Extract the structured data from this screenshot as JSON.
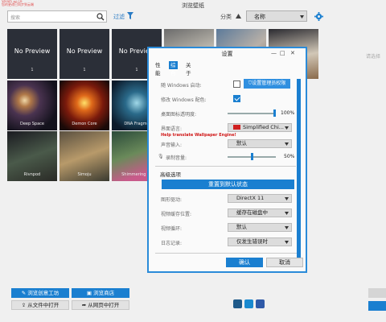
{
  "window": {
    "title": "浏览壁纸",
    "brand_line1": "Steam 云已开",
    "brand_line2": "您的更改已同步到云端"
  },
  "toolbar": {
    "search_placeholder": "搜索",
    "filter_label": "过滤",
    "sort_label": "分类",
    "sort_value": "名称"
  },
  "grid": {
    "tiles": [
      {
        "title": "No Preview",
        "count": "1"
      },
      {
        "title": "No Preview",
        "count": "1"
      },
      {
        "title": "No Preview",
        "count": "1"
      },
      {
        "title": ""
      },
      {
        "title": ""
      },
      {
        "title": ""
      },
      {
        "title": "Deep Space"
      },
      {
        "title": "Demon Core"
      },
      {
        "title": "DNA Fragme"
      },
      {
        "title": "Rivnpod"
      },
      {
        "title": "Simoju"
      },
      {
        "title": "Shimmering Pa"
      }
    ]
  },
  "right_hint": "请选择",
  "bottom": {
    "workshop": "浏览创意工坊",
    "store": "浏览商店",
    "open_file": "从文件中打开",
    "open_web": "从网页中打开"
  },
  "settings": {
    "title": "设置",
    "tabs": [
      "性能",
      "综合",
      "关于"
    ],
    "rows": {
      "autostart": "随 Windows 启动:",
      "autostart_button": "设置管理员权限",
      "windows_color": "修改 Windows 配色:",
      "icon_opacity": "桌面图标透明度:",
      "icon_opacity_value": "100%",
      "language": "界面语言:",
      "language_value": "Simplified Chi...",
      "help_translate": "Help translate Wallpaper Engine!",
      "audio_input": "声音输入:",
      "audio_input_value": "默认",
      "volume": "录制音量:",
      "volume_value": "50%"
    },
    "advanced": {
      "title": "高级选项",
      "restore": "重置到默认状态",
      "renderer": "图形驱动:",
      "renderer_value": "DirectX 11",
      "video_storage": "视频缓存位置:",
      "video_storage_value": "缓存在磁盘中",
      "video_loop": "视频循环:",
      "video_loop_value": "默认",
      "log": "日志记录:",
      "log_value": "仅发生错误时"
    },
    "ok": "确认",
    "cancel": "取消",
    "states": {
      "autostart_checked": false,
      "windows_color_checked": true,
      "icon_opacity_level": 1.0,
      "volume_level": 0.5
    }
  },
  "colors": {
    "accent": "#1a7fd0",
    "dialog_border": "#2a8bd9",
    "help_text": "#d01818"
  }
}
